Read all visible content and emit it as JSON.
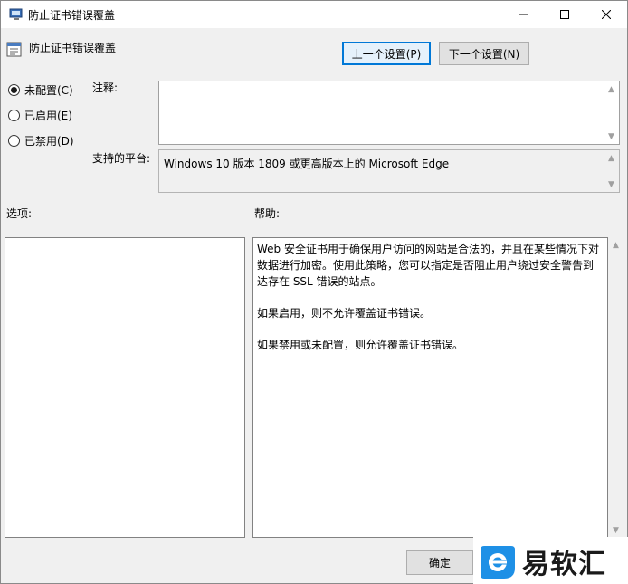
{
  "window": {
    "title": "防止证书错误覆盖"
  },
  "header": {
    "policy_name": "防止证书错误覆盖",
    "prev_button": "上一个设置(P)",
    "next_button": "下一个设置(N)"
  },
  "state": {
    "options": [
      {
        "label": "未配置(C)",
        "checked": true
      },
      {
        "label": "已启用(E)",
        "checked": false
      },
      {
        "label": "已禁用(D)",
        "checked": false
      }
    ]
  },
  "fields": {
    "comment_label": "注释:",
    "comment_value": "",
    "platform_label": "支持的平台:",
    "platform_value": "Windows 10 版本 1809 或更高版本上的 Microsoft Edge"
  },
  "panels": {
    "options_label": "选项:",
    "help_label": "帮助:",
    "help_paragraphs": [
      "Web 安全证书用于确保用户访问的网站是合法的，并且在某些情况下对数据进行加密。使用此策略，您可以指定是否阻止用户绕过安全警告到达存在 SSL 错误的站点。",
      "如果启用，则不允许覆盖证书错误。",
      "如果禁用或未配置，则允许覆盖证书错误。"
    ]
  },
  "footer": {
    "ok_button": "确定"
  },
  "watermark": {
    "text": "易软汇"
  },
  "colors": {
    "focus_border": "#0078d7",
    "logo_blue": "#1e90e6"
  },
  "icons": {
    "title": "policy-setting-icon",
    "header": "policy-page-icon"
  }
}
